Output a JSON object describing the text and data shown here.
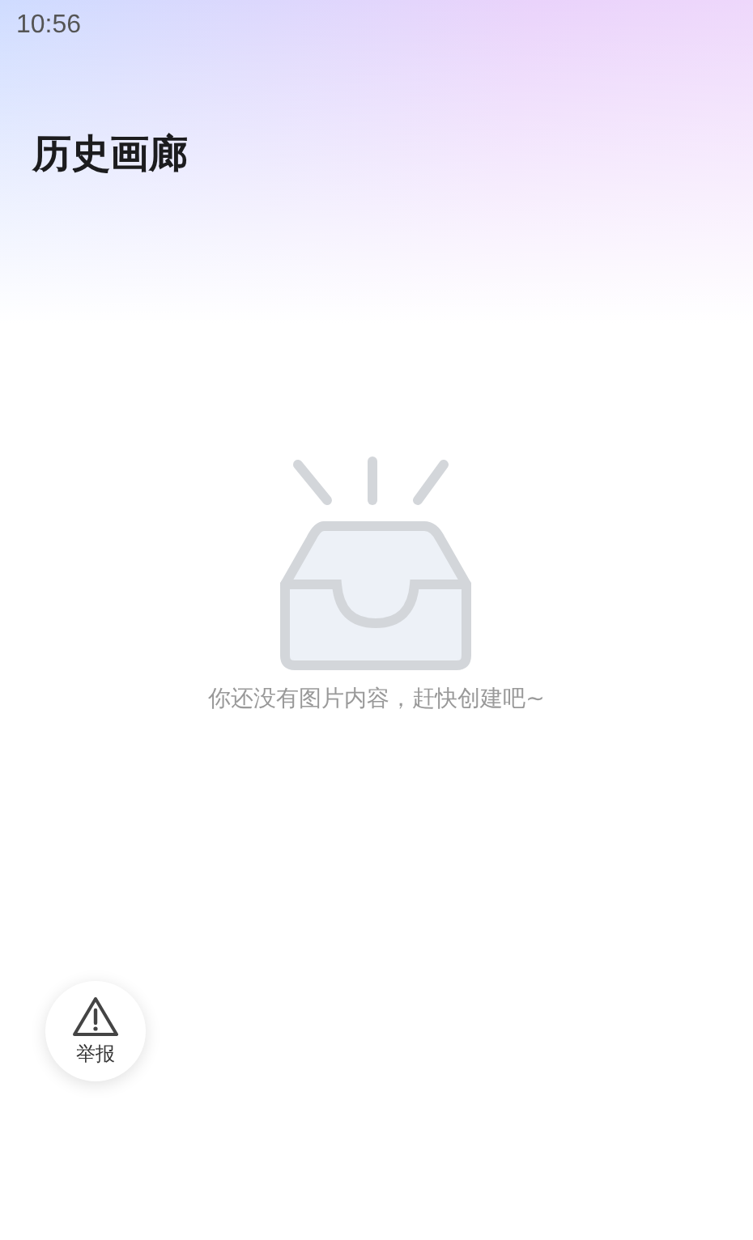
{
  "status_bar": {
    "time": "10:56"
  },
  "header": {
    "title": "历史画廊"
  },
  "empty_state": {
    "message": "你还没有图片内容，赶快创建吧~"
  },
  "report_button": {
    "label": "举报"
  }
}
